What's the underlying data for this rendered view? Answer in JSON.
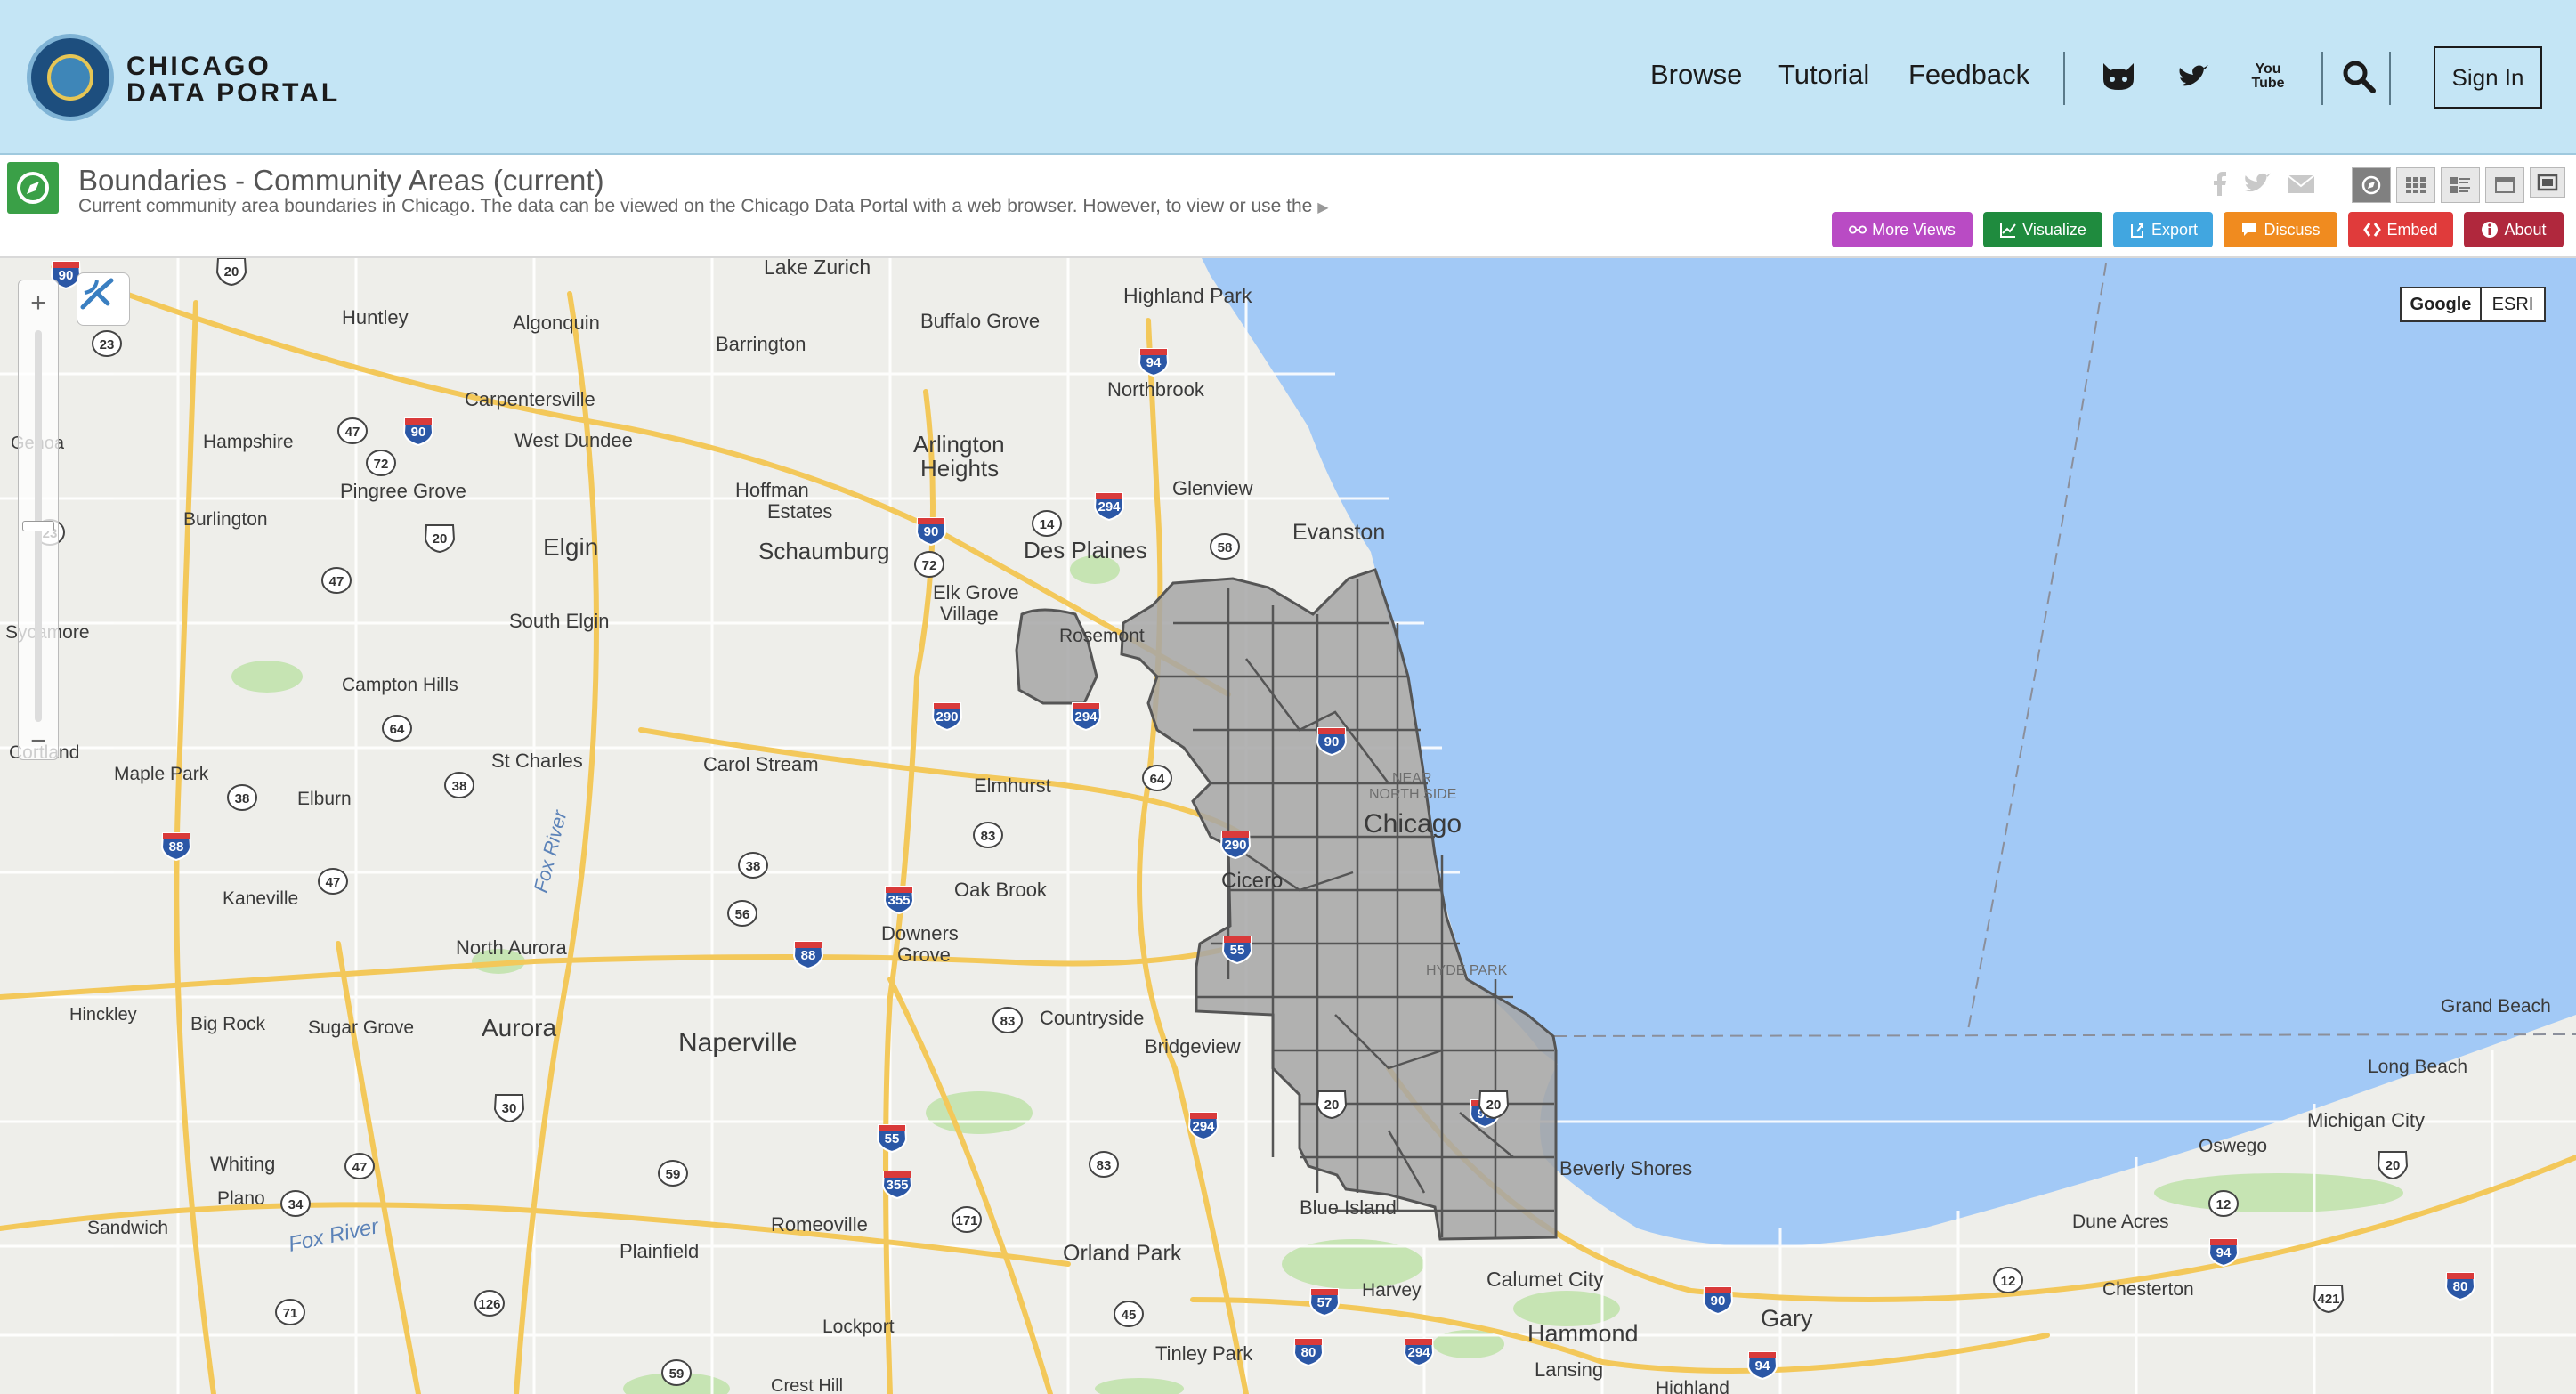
{
  "header": {
    "logo_line1": "CHICAGO",
    "logo_line2": "DATA PORTAL",
    "nav": [
      {
        "label": "Browse"
      },
      {
        "label": "Tutorial"
      },
      {
        "label": "Feedback"
      }
    ],
    "icons": [
      "github-icon",
      "twitter-icon",
      "youtube-icon",
      "search-icon"
    ],
    "youtube_line1": "You",
    "youtube_line2": "Tube",
    "signin_label": "Sign In"
  },
  "dataset": {
    "title": "Boundaries - Community Areas (current)",
    "description": "Current community area boundaries in Chicago. The data can be viewed on the Chicago Data Portal with a web browser. However, to view or use the",
    "share_icons": [
      "facebook-icon",
      "twitter-icon",
      "email-icon"
    ],
    "view_icons": [
      "map-view-icon",
      "grid-view-icon",
      "list-view-icon",
      "page-view-icon",
      "fullscreen-icon"
    ],
    "actions": [
      {
        "label": "More Views",
        "color": "#b94bc4",
        "icon": "glasses-icon"
      },
      {
        "label": "Visualize",
        "color": "#1f8b3e",
        "icon": "chart-icon"
      },
      {
        "label": "Export",
        "color": "#41a6e0",
        "icon": "export-icon"
      },
      {
        "label": "Discuss",
        "color": "#f08b1f",
        "icon": "speech-bubble-icon"
      },
      {
        "label": "Embed",
        "color": "#e03b3b",
        "icon": "code-icon"
      },
      {
        "label": "About",
        "color": "#b0283d",
        "icon": "info-icon"
      }
    ]
  },
  "map": {
    "zoom_in": "+",
    "zoom_out": "−",
    "basemaps": [
      {
        "label": "Google",
        "selected": true
      },
      {
        "label": "ESRI",
        "selected": false
      }
    ],
    "colors": {
      "water": "#a2c9f6",
      "land": "#eeeeea",
      "highway": "#f3c85a",
      "park": "#c6e4b3",
      "boundary_fill": "#a6a6a6",
      "boundary_stroke": "#555555"
    },
    "places": [
      {
        "name": "Lake Zurich"
      },
      {
        "name": "Highland Park"
      },
      {
        "name": "Huntley"
      },
      {
        "name": "Algonquin"
      },
      {
        "name": "Barrington"
      },
      {
        "name": "Buffalo Grove"
      },
      {
        "name": "Northbrook"
      },
      {
        "name": "Carpentersville"
      },
      {
        "name": "Genoa"
      },
      {
        "name": "Hampshire"
      },
      {
        "name": "West Dundee"
      },
      {
        "name": "Arlington"
      },
      {
        "name": "Heights"
      },
      {
        "name": "Glenview"
      },
      {
        "name": "Pingree Grove"
      },
      {
        "name": "Hoffman"
      },
      {
        "name": "Estates"
      },
      {
        "name": "Burlington"
      },
      {
        "name": "Elgin"
      },
      {
        "name": "Schaumburg"
      },
      {
        "name": "Des Plaines"
      },
      {
        "name": "Evanston"
      },
      {
        "name": "Elk Grove"
      },
      {
        "name": "Village"
      },
      {
        "name": "Rosemont"
      },
      {
        "name": "Sycamore"
      },
      {
        "name": "South Elgin"
      },
      {
        "name": "Campton Hills"
      },
      {
        "name": "Cortland"
      },
      {
        "name": "Maple Park"
      },
      {
        "name": "St Charles"
      },
      {
        "name": "Carol Stream"
      },
      {
        "name": "Elmhurst"
      },
      {
        "name": "Elburn"
      },
      {
        "name": "NEAR"
      },
      {
        "name": "NORTH SIDE"
      },
      {
        "name": "Chicago"
      },
      {
        "name": "Fox River"
      },
      {
        "name": "Kaneville"
      },
      {
        "name": "Oak Brook"
      },
      {
        "name": "Cicero"
      },
      {
        "name": "Downers"
      },
      {
        "name": "Grove"
      },
      {
        "name": "North Aurora"
      },
      {
        "name": "HYDE PARK"
      },
      {
        "name": "Grand Beach"
      },
      {
        "name": "Hinckley"
      },
      {
        "name": "Big Rock"
      },
      {
        "name": "Sugar Grove"
      },
      {
        "name": "Aurora"
      },
      {
        "name": "Naperville"
      },
      {
        "name": "Countryside"
      },
      {
        "name": "Bridgeview"
      },
      {
        "name": "Long Beach"
      },
      {
        "name": "Michigan City"
      },
      {
        "name": "Oswego"
      },
      {
        "name": "Beverly Shores"
      },
      {
        "name": "Whiting"
      },
      {
        "name": "Plano"
      },
      {
        "name": "Blue Island"
      },
      {
        "name": "Sandwich"
      },
      {
        "name": "Fox River"
      },
      {
        "name": "Romeoville"
      },
      {
        "name": "Dune Acres"
      },
      {
        "name": "Plainfield"
      },
      {
        "name": "Orland Park"
      },
      {
        "name": "Calumet City"
      },
      {
        "name": "Harvey"
      },
      {
        "name": "Chesterton"
      },
      {
        "name": "Gary"
      },
      {
        "name": "Hammond"
      },
      {
        "name": "Lockport"
      },
      {
        "name": "Tinley Park"
      },
      {
        "name": "Lansing"
      },
      {
        "name": "Crest Hill"
      },
      {
        "name": "Highland"
      }
    ],
    "route_shields": [
      "90",
      "20",
      "23",
      "94",
      "47",
      "90",
      "72",
      "294",
      "90",
      "14",
      "58",
      "72",
      "23",
      "20",
      "47",
      "290",
      "294",
      "64",
      "90",
      "38",
      "64",
      "38",
      "290",
      "88",
      "47",
      "83",
      "38",
      "56",
      "355",
      "55",
      "88",
      "83",
      "30",
      "47",
      "294",
      "55",
      "59",
      "355",
      "83",
      "171",
      "20",
      "34",
      "90",
      "71",
      "126",
      "45",
      "57",
      "12",
      "90",
      "421",
      "80",
      "80",
      "294",
      "94",
      "20",
      "94",
      "59",
      "12",
      "20"
    ]
  }
}
